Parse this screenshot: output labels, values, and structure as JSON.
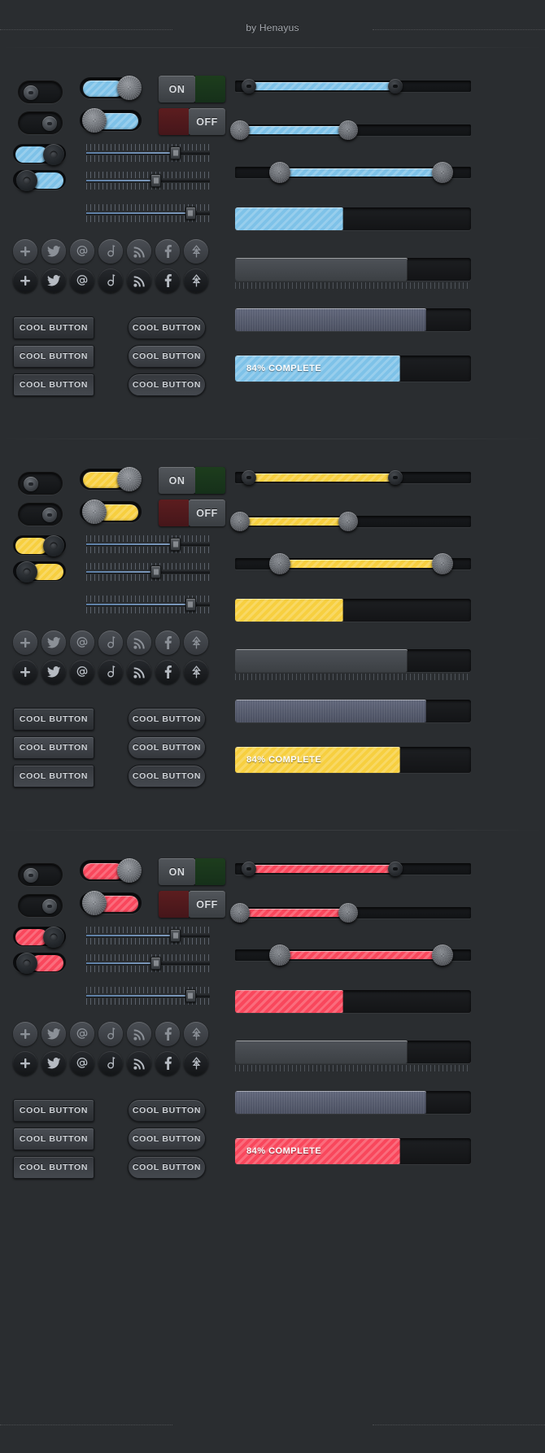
{
  "header": {
    "byline": "by Henayus"
  },
  "colors": {
    "blue": "#7ec2e8",
    "yellow": "#f7cf3f",
    "red": "#f9475c",
    "background": "#2a2d30",
    "track": "#16181b",
    "green_pane": "#1d3d1d",
    "red_pane": "#5c1d1f"
  },
  "switch_labels": {
    "on": "ON",
    "off": "OFF"
  },
  "button_label": "COOL BUTTON",
  "progress": {
    "label": "84% COMPLETE",
    "percent": 84
  },
  "icons": [
    {
      "name": "plus-icon",
      "glyph": "+"
    },
    {
      "name": "twitter-icon",
      "glyph": "twitter"
    },
    {
      "name": "email-at-icon",
      "glyph": "@"
    },
    {
      "name": "dribbble-icon",
      "glyph": "d"
    },
    {
      "name": "rss-icon",
      "glyph": "rss"
    },
    {
      "name": "facebook-icon",
      "glyph": "f"
    },
    {
      "name": "forrst-icon",
      "glyph": "tree"
    }
  ],
  "sections": [
    {
      "accent_name": "blue",
      "accent": "#7ec2e8",
      "toggles": [
        {
          "name": "toggle-pill-off-left",
          "state": "left"
        },
        {
          "name": "toggle-pill-off-right",
          "state": "right"
        },
        {
          "name": "toggle-filled-on",
          "state": "on"
        },
        {
          "name": "toggle-filled-off",
          "state": "off"
        },
        {
          "name": "toggle-rounded-on",
          "state": "on"
        },
        {
          "name": "toggle-rounded-off",
          "state": "off"
        }
      ],
      "sliders": [
        {
          "name": "ruler-slider-1",
          "value": 72
        },
        {
          "name": "ruler-slider-2",
          "value": 56
        },
        {
          "name": "ruler-slider-3",
          "value": 84
        }
      ],
      "ranges": [
        {
          "name": "range-slider-dots",
          "start": 6,
          "end": 68
        },
        {
          "name": "range-slider-screws",
          "start": 2,
          "end": 48
        },
        {
          "name": "range-slider-big",
          "start": 19,
          "end": 88
        }
      ],
      "bars": [
        {
          "name": "progress-accent",
          "percent": 46,
          "style": "accent",
          "label": ""
        },
        {
          "name": "progress-grey",
          "percent": 73,
          "style": "grey",
          "label": ""
        },
        {
          "name": "progress-ribbed",
          "percent": 81,
          "style": "ribbed",
          "label": ""
        },
        {
          "name": "progress-complete",
          "percent": 70,
          "style": "accent",
          "label": "84% COMPLETE"
        }
      ]
    },
    {
      "accent_name": "yellow",
      "accent": "#f7cf3f",
      "toggles": [
        {
          "name": "toggle-pill-off-left",
          "state": "left"
        },
        {
          "name": "toggle-pill-off-right",
          "state": "right"
        },
        {
          "name": "toggle-filled-on",
          "state": "on"
        },
        {
          "name": "toggle-filled-off",
          "state": "off"
        },
        {
          "name": "toggle-rounded-on",
          "state": "on"
        },
        {
          "name": "toggle-rounded-off",
          "state": "off"
        }
      ],
      "sliders": [
        {
          "name": "ruler-slider-1",
          "value": 72
        },
        {
          "name": "ruler-slider-2",
          "value": 56
        },
        {
          "name": "ruler-slider-3",
          "value": 84
        }
      ],
      "ranges": [
        {
          "name": "range-slider-dots",
          "start": 6,
          "end": 68
        },
        {
          "name": "range-slider-screws",
          "start": 2,
          "end": 48
        },
        {
          "name": "range-slider-big",
          "start": 19,
          "end": 88
        }
      ],
      "bars": [
        {
          "name": "progress-accent",
          "percent": 46,
          "style": "accent",
          "label": ""
        },
        {
          "name": "progress-grey",
          "percent": 73,
          "style": "grey",
          "label": ""
        },
        {
          "name": "progress-ribbed",
          "percent": 81,
          "style": "ribbed",
          "label": ""
        },
        {
          "name": "progress-complete",
          "percent": 70,
          "style": "accent",
          "label": "84% COMPLETE"
        }
      ]
    },
    {
      "accent_name": "red",
      "accent": "#f9475c",
      "toggles": [
        {
          "name": "toggle-pill-off-left",
          "state": "left"
        },
        {
          "name": "toggle-pill-off-right",
          "state": "right"
        },
        {
          "name": "toggle-filled-on",
          "state": "on"
        },
        {
          "name": "toggle-filled-off",
          "state": "off"
        },
        {
          "name": "toggle-rounded-on",
          "state": "on"
        },
        {
          "name": "toggle-rounded-off",
          "state": "off"
        }
      ],
      "sliders": [
        {
          "name": "ruler-slider-1",
          "value": 72
        },
        {
          "name": "ruler-slider-2",
          "value": 56
        },
        {
          "name": "ruler-slider-3",
          "value": 84
        }
      ],
      "ranges": [
        {
          "name": "range-slider-dots",
          "start": 6,
          "end": 68
        },
        {
          "name": "range-slider-screws",
          "start": 2,
          "end": 48
        },
        {
          "name": "range-slider-big",
          "start": 19,
          "end": 88
        }
      ],
      "bars": [
        {
          "name": "progress-accent",
          "percent": 46,
          "style": "accent",
          "label": ""
        },
        {
          "name": "progress-grey",
          "percent": 73,
          "style": "grey",
          "label": ""
        },
        {
          "name": "progress-ribbed",
          "percent": 81,
          "style": "ribbed",
          "label": ""
        },
        {
          "name": "progress-complete",
          "percent": 70,
          "style": "accent",
          "label": "84% COMPLETE"
        }
      ]
    }
  ]
}
